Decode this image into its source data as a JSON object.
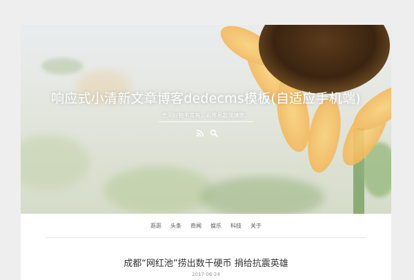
{
  "site": {
    "title": "响应式小清新文章博客dedecms模板(自适应手机端)",
    "subtitle": "世间好物不常有，彩霞易散琉璃脆。"
  },
  "hero": {
    "icons": [
      "rss-icon",
      "search-icon"
    ]
  },
  "nav": {
    "items": [
      {
        "label": "逛逛"
      },
      {
        "label": "头条"
      },
      {
        "label": "奇闻"
      },
      {
        "label": "娱乐"
      },
      {
        "label": "科技"
      },
      {
        "label": "关于"
      }
    ]
  },
  "post": {
    "title": "成都“网红池”捞出数千硬币 捐给抗震英雄",
    "date": "2017-06-24"
  },
  "colors": {
    "page_bg": "#eeeeee",
    "nav_text": "#555555",
    "title_text": "#333333",
    "date_text": "#999999"
  }
}
